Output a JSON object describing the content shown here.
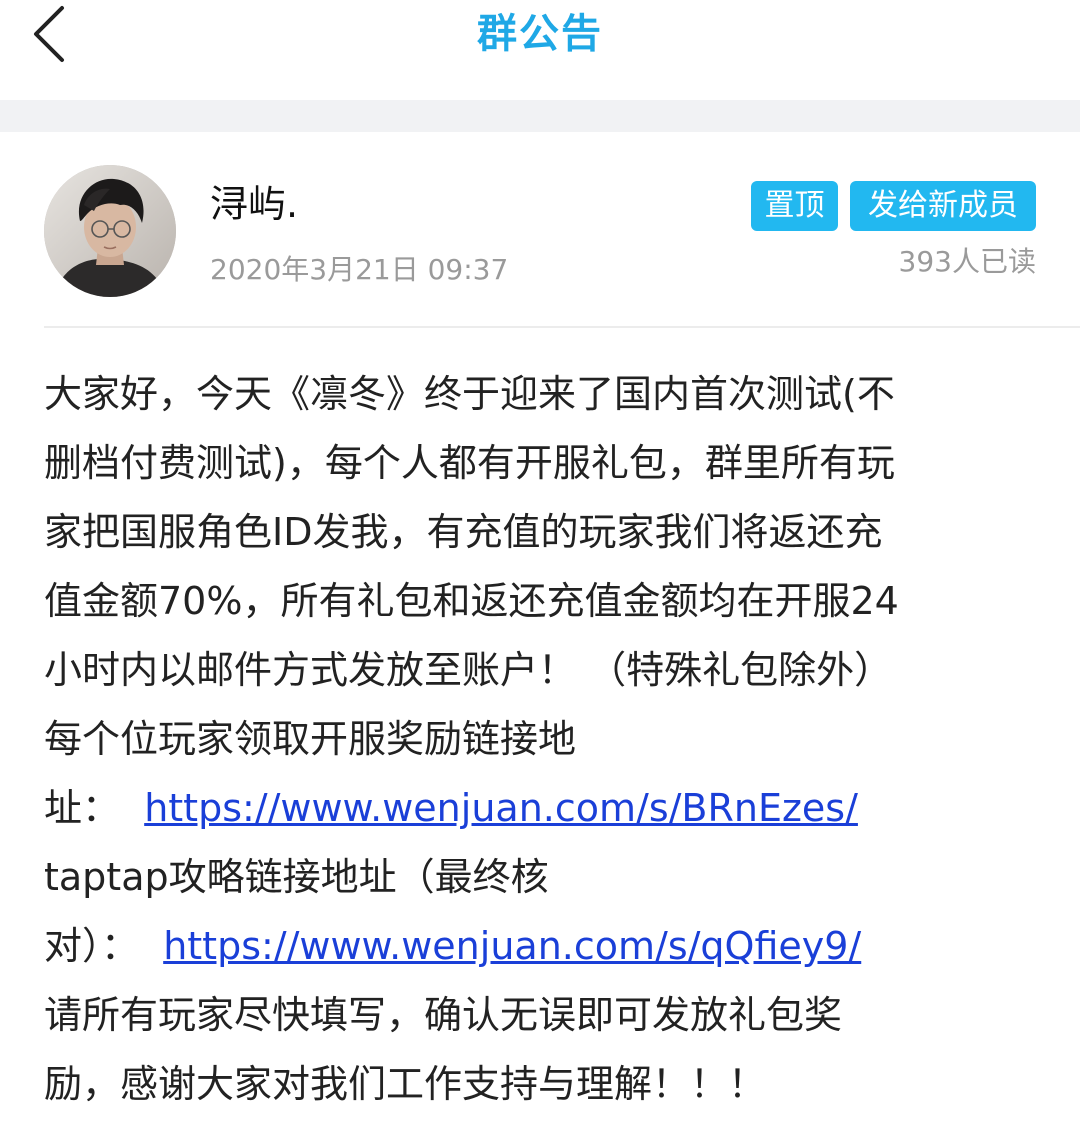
{
  "header": {
    "title": "群公告",
    "back_icon": "chevron-left-icon"
  },
  "colors": {
    "accent": "#1fa8e6",
    "tag_bg": "#22b8f0",
    "link": "#1a3fd8",
    "meta_text": "#9a9a9a"
  },
  "announcement": {
    "author": "浔屿.",
    "time": "2020年3月21日 09:37",
    "tags": [
      "置顶",
      "发给新成员"
    ],
    "read_count": "393人已读",
    "lines": [
      "大家好，今天《凛冬》终于迎来了国内首次测试(不",
      "删档付费测试)，每个人都有开服礼包，群里所有玩",
      "家把国服角色ID发我，有充值的玩家我们将返还充",
      "值金额70%，所有礼包和返还充值金额均在开服24",
      "小时内以邮件方式发放至账户！ （特殊礼包除外）",
      "每个位玩家领取开服奖励链接地"
    ],
    "link1_prefix": "址：",
    "link1": "https://www.wenjuan.com/s/BRnEzes/",
    "line_taptap": "taptap攻略链接地址（最终核",
    "link2_prefix": "对）：",
    "link2": "https://www.wenjuan.com/s/qQfiey9/",
    "closing_lines": [
      "请所有玩家尽快填写，确认无误即可发放礼包奖",
      "励，感谢大家对我们工作支持与理解！！！"
    ]
  }
}
